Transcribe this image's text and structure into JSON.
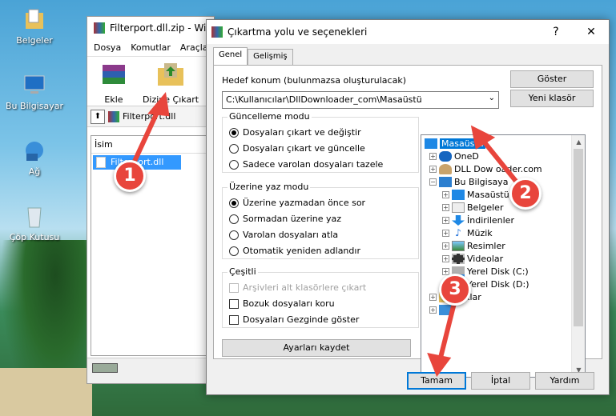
{
  "desktop": {
    "icons": [
      {
        "label": "Belgeler",
        "icon": "folder-documents-icon"
      },
      {
        "label": "Bu Bilgisayar",
        "icon": "computer-icon"
      },
      {
        "label": "Ağ",
        "icon": "network-icon"
      },
      {
        "label": "Çöp Kutusu",
        "icon": "recycle-bin-icon"
      }
    ]
  },
  "winrar": {
    "title": "Filterport.dll.zip - Wi",
    "menu": [
      "Dosya",
      "Komutlar",
      "Araçla"
    ],
    "tools": [
      "Ekle",
      "Dizine Çıkart"
    ],
    "address": "Filterport.dll",
    "list_header": "İsim",
    "file": "Filterport.dll"
  },
  "dialog": {
    "title": "Çıkartma yolu ve seçenekleri",
    "tabs": [
      "Genel",
      "Gelişmiş"
    ],
    "dest_label": "Hedef konum (bulunmazsa oluşturulacak)",
    "dest_value": "C:\\Kullanıcılar\\DllDownloader_com\\Masaüstü",
    "show_button": "Göster",
    "new_folder_button": "Yeni klasör",
    "update_group": {
      "title": "Güncelleme modu",
      "options": [
        "Dosyaları çıkart ve değiştir",
        "Dosyaları çıkart ve güncelle",
        "Sadece varolan dosyaları tazele"
      ]
    },
    "overwrite_group": {
      "title": "Üzerine yaz modu",
      "options": [
        "Üzerine yazmadan önce sor",
        "Sormadan üzerine yaz",
        "Varolan dosyaları atla",
        "Otomatik yeniden adlandır"
      ]
    },
    "misc_group": {
      "title": "Çeşitli",
      "options": [
        "Arşivleri alt klasörlere çıkart",
        "Bozuk dosyaları koru",
        "Dosyaları Gezginde göster"
      ]
    },
    "save_settings_button": "Ayarları kaydet",
    "tree": [
      "Masaüstü",
      "OneD",
      "DLL Dow    oader.com",
      "Bu Bilgisaya",
      "Masaüstü",
      "Belgeler",
      "İndirilenler",
      "Müzik",
      "Resimler",
      "Videolar",
      "Yerel Disk (C:)",
      "Yerel Disk (D:)",
      "   plıklar",
      ""
    ],
    "ok_button": "Tamam",
    "cancel_button": "İptal",
    "help_button": "Yardım",
    "help_glyph": "?",
    "close_glyph": "✕"
  },
  "callouts": [
    "1",
    "2",
    "3"
  ],
  "colors": {
    "accent": "#0078d7",
    "callout": "#e8453c"
  }
}
